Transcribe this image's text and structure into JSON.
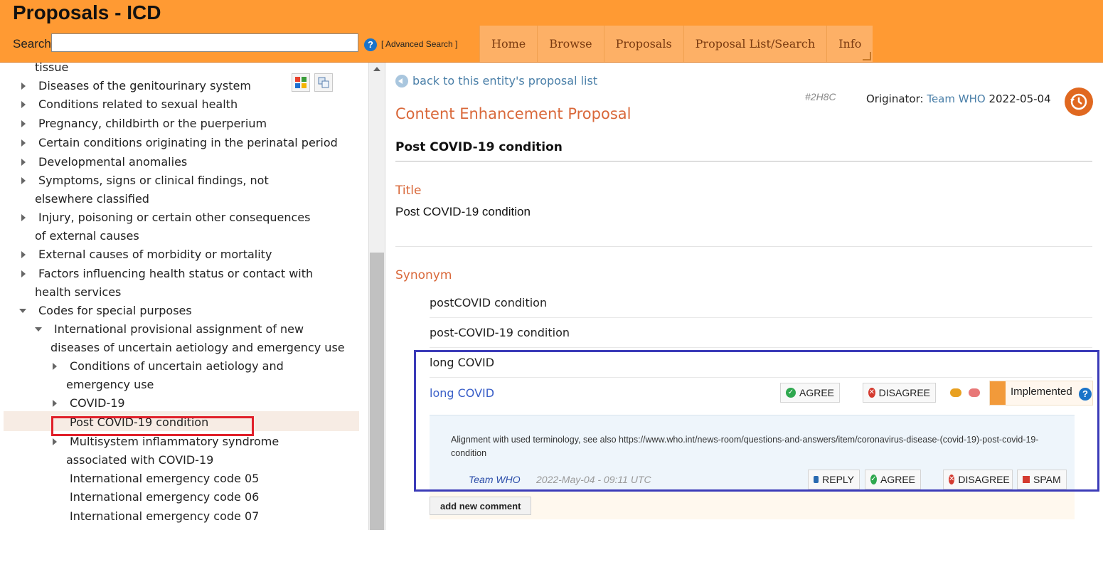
{
  "app": {
    "title": "Proposals - ICD"
  },
  "search": {
    "label": "Search",
    "value": "",
    "advanced_label": "[ Advanced Search ]"
  },
  "nav": {
    "tabs": [
      "Home",
      "Browse",
      "Proposals",
      "Proposal List/Search",
      "Info"
    ]
  },
  "sidebar": {
    "items": [
      {
        "label": "tissue"
      },
      {
        "label": "Diseases of the genitourinary system"
      },
      {
        "label": "Conditions related to sexual health"
      },
      {
        "label": "Pregnancy, childbirth or the puerperium"
      },
      {
        "label": "Certain conditions originating in the perinatal period"
      },
      {
        "label": "Developmental anomalies"
      },
      {
        "label": "Symptoms, signs or clinical findings, not elsewhere classified"
      },
      {
        "label": "Injury, poisoning or certain other consequences of external causes"
      },
      {
        "label": "External causes of morbidity or mortality"
      },
      {
        "label": "Factors influencing health status or contact with health services"
      },
      {
        "label": "Codes for special purposes"
      },
      {
        "label": "International provisional assignment of new diseases of uncertain aetiology and emergency use"
      },
      {
        "label": "Conditions of uncertain aetiology and emergency use"
      },
      {
        "label": "COVID-19"
      },
      {
        "label": "Post COVID-19 condition"
      },
      {
        "label": "Multisystem inflammatory syndrome associated with COVID-19"
      },
      {
        "label": "International emergency code 05"
      },
      {
        "label": "International emergency code 06"
      },
      {
        "label": "International emergency code 07"
      }
    ]
  },
  "main": {
    "back_link": "back to this entity's proposal list",
    "proposal_id": "#2H8C",
    "originator_label": "Originator:",
    "originator_name": "Team WHO",
    "originator_date": "2022-05-04",
    "page_title": "Content Enhancement Proposal",
    "entity_title": "Post COVID-19 condition",
    "title_section": {
      "heading": "Title",
      "value": "Post COVID-19 condition"
    },
    "synonym_section": {
      "heading": "Synonym",
      "items": [
        "postCOVID condition",
        "post-COVID-19 condition",
        "long COVID"
      ],
      "proposed": "long COVID"
    },
    "actions": {
      "agree": "AGREE",
      "disagree": "DISAGREE",
      "status": "Implemented"
    },
    "comment": {
      "text": "Alignment with used terminology, see also https://www.who.int/news-room/questions-and-answers/item/coronavirus-disease-(covid-19)-post-covid-19-condition",
      "author": "Team WHO",
      "date": "2022-May-04 - 09:11 UTC",
      "reply": "REPLY",
      "agree": "AGREE",
      "disagree": "DISAGREE",
      "spam": "SPAM"
    },
    "add_comment": "add new comment"
  },
  "colors": {
    "header": "#ff9a33",
    "accent": "#d9683a",
    "link": "#4a7fa8",
    "highlight_red": "#e0202a",
    "highlight_blue": "#3b3bb8"
  }
}
